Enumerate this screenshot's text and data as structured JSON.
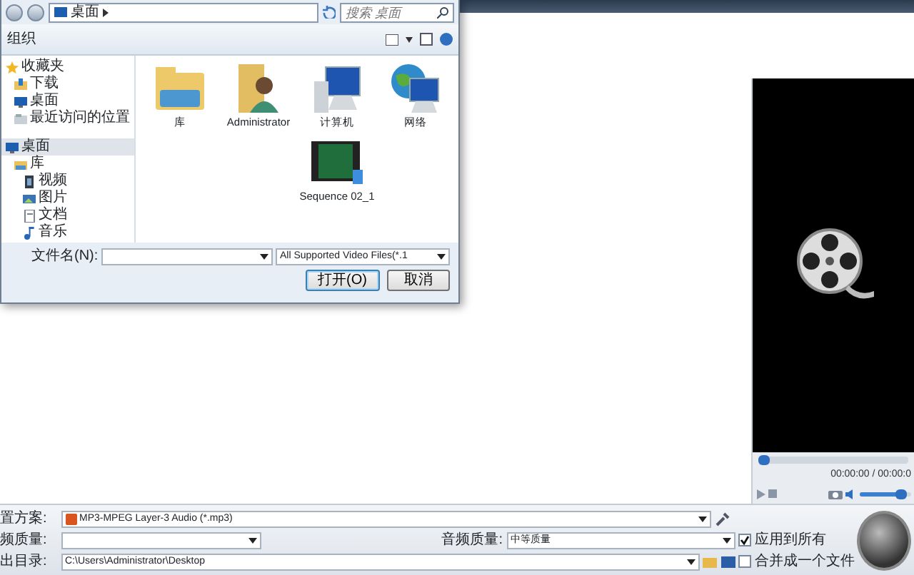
{
  "dialog": {
    "breadcrumb": "桌面",
    "search": {
      "placeholder": "搜索 桌面"
    },
    "toolbar": {
      "organize": "组织"
    },
    "sidebar": {
      "items": [
        {
          "label": "收藏夹",
          "kind": "favorites",
          "selected": false,
          "children": [
            {
              "label": "下载",
              "kind": "downloads",
              "selected": false
            },
            {
              "label": "桌面",
              "kind": "desktop",
              "selected": false
            },
            {
              "label": "最近访问的位置",
              "kind": "recent",
              "selected": false
            }
          ]
        },
        {
          "label": "桌面",
          "kind": "desktop",
          "selected": true,
          "children": [
            {
              "label": "库",
              "kind": "library",
              "selected": false,
              "children": [
                {
                  "label": "视频",
                  "kind": "videos",
                  "selected": false
                },
                {
                  "label": "图片",
                  "kind": "pictures",
                  "selected": false
                },
                {
                  "label": "文档",
                  "kind": "documents",
                  "selected": false
                },
                {
                  "label": "音乐",
                  "kind": "music",
                  "selected": false
                }
              ]
            }
          ]
        }
      ]
    },
    "files": [
      {
        "name": "库",
        "kind": "library"
      },
      {
        "name": "Administrator",
        "kind": "user"
      },
      {
        "name": "计算机",
        "kind": "computer"
      },
      {
        "name": "网络",
        "kind": "network"
      },
      {
        "name": "Sequence 02_1",
        "kind": "video"
      }
    ],
    "file_name": {
      "label": "文件名(N):"
    },
    "file_type": "All Supported Video Files(*.1",
    "buttons": [
      {
        "label": "打开(O)",
        "default": true
      },
      {
        "label": "取消",
        "default": false
      }
    ]
  },
  "player": {
    "seek": {
      "level": 0
    },
    "time": "00:00:00 / 00:00:0",
    "volume": {
      "level": 0.9
    }
  },
  "settings": {
    "preset": {
      "label": "置方案:",
      "value": "MP3-MPEG Layer-3 Audio (*.mp3)"
    },
    "video_quality": {
      "label": "频质量:"
    },
    "audio_quality": {
      "label": "音频质量:",
      "value": "中等质量"
    },
    "apply_all": {
      "label": "应用到所有",
      "checked": true
    },
    "output": {
      "label": "出目录:",
      "value": "C:\\Users\\Administrator\\Desktop"
    },
    "merge": {
      "label": "合并成一个文件",
      "checked": false
    }
  }
}
